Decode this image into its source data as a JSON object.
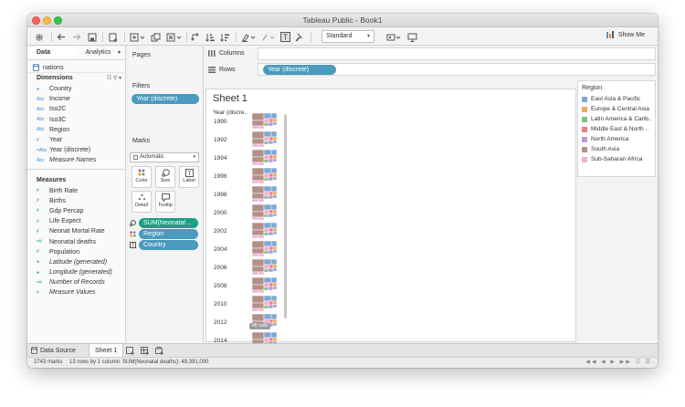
{
  "window": {
    "title": "Tableau Public - Book1"
  },
  "toolbar": {
    "standard_label": "Standard",
    "show_me_label": "Show Me"
  },
  "left_pane": {
    "tabs": [
      {
        "label": "Data"
      },
      {
        "label": "Analytics"
      }
    ],
    "data_source": "nations",
    "dimensions_title": "Dimensions",
    "dimensions": [
      {
        "type": "globe",
        "label": "Country",
        "italic": false
      },
      {
        "type": "Abc",
        "label": "Income",
        "italic": false
      },
      {
        "type": "Abc",
        "label": "Iso2C",
        "italic": false
      },
      {
        "type": "Abc",
        "label": "Iso3C",
        "italic": false
      },
      {
        "type": "Abc",
        "label": "Region",
        "italic": false
      },
      {
        "type": "#",
        "label": "Year",
        "italic": false
      },
      {
        "type": "=Abc",
        "label": "Year (discrete)",
        "italic": false
      },
      {
        "type": "Abc",
        "label": "Measure Names",
        "italic": true
      }
    ],
    "measures_title": "Measures",
    "measures": [
      {
        "type": "#",
        "label": "Birth Rate",
        "italic": false
      },
      {
        "type": "#",
        "label": "Births",
        "italic": false
      },
      {
        "type": "#",
        "label": "Gdp Percap",
        "italic": false
      },
      {
        "type": "#",
        "label": "Life Expect",
        "italic": false
      },
      {
        "type": "#",
        "label": "Neonat Mortal Rate",
        "italic": false
      },
      {
        "type": "=#",
        "label": "Neonatal deaths",
        "italic": false
      },
      {
        "type": "#",
        "label": "Population",
        "italic": false
      },
      {
        "type": "globe",
        "label": "Latitude (generated)",
        "italic": true
      },
      {
        "type": "globe",
        "label": "Longitude (generated)",
        "italic": true
      },
      {
        "type": "=#",
        "label": "Number of Records",
        "italic": true
      },
      {
        "type": "#",
        "label": "Measure Values",
        "italic": true
      }
    ]
  },
  "cards": {
    "pages_title": "Pages",
    "filters_title": "Filters",
    "filter_pill": "Year (discrete)",
    "marks_title": "Marks",
    "marks_type": "Automatic",
    "mark_buttons": [
      {
        "label": "Color",
        "icon": "color-icon"
      },
      {
        "label": "Size",
        "icon": "size-icon"
      },
      {
        "label": "Label",
        "icon": "label-icon"
      },
      {
        "label": "Detail",
        "icon": "detail-icon"
      },
      {
        "label": "Tooltip",
        "icon": "tooltip-icon"
      }
    ],
    "mark_fields": [
      {
        "icon": "size-icon",
        "label": "SUM(Neonatal ..",
        "color": "green"
      },
      {
        "icon": "color-icon",
        "label": "Region",
        "color": "blue"
      },
      {
        "icon": "label-icon",
        "label": "Country",
        "color": "blue"
      }
    ]
  },
  "shelves": {
    "columns_label": "Columns",
    "rows_label": "Rows",
    "rows_pill": "Year (discrete)"
  },
  "view": {
    "sheet_title": "Sheet 1",
    "column_header": "Year (discre..",
    "years": [
      "1990",
      "1992",
      "1994",
      "1996",
      "1998",
      "2000",
      "2002",
      "2004",
      "2006",
      "2008",
      "2010",
      "2012",
      "2014"
    ],
    "nulls_badge": "48 nulls"
  },
  "legend": {
    "title": "Region",
    "items": [
      {
        "label": "East Asia & Pacific",
        "color": "#7fa7d6"
      },
      {
        "label": "Europe & Central Asia",
        "color": "#f1a85a"
      },
      {
        "label": "Latin America & Carib..",
        "color": "#7cc17a"
      },
      {
        "label": "Middle East & North ..",
        "color": "#e9807a"
      },
      {
        "label": "North America",
        "color": "#b69bd4"
      },
      {
        "label": "South Asia",
        "color": "#b39087"
      },
      {
        "label": "Sub-Saharan Africa",
        "color": "#f1b1d1"
      }
    ]
  },
  "bottom_tabs": {
    "data_source": "Data Source",
    "sheet": "Sheet 1"
  },
  "status": {
    "marks": "2743 marks",
    "rows_cols": "13 rows by 1 column",
    "sum": "SUM(Neonatal deaths): 49,391,000"
  }
}
